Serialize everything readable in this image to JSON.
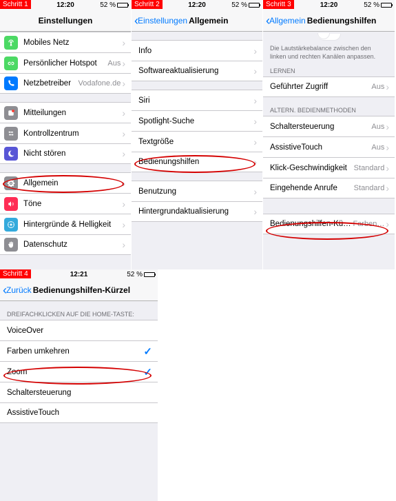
{
  "status": {
    "time": "12:20",
    "time4": "12:21",
    "battery": "52 %"
  },
  "steps": {
    "s1": "Schritt 1",
    "s2": "Schritt 2",
    "s3": "Schritt 3",
    "s4": "Schritt 4"
  },
  "p1": {
    "title": "Einstellungen",
    "items_a": [
      {
        "label": "Mobiles Netz"
      },
      {
        "label": "Persönlicher Hotspot",
        "detail": "Aus"
      },
      {
        "label": "Netzbetreiber",
        "detail": "Vodafone.de"
      }
    ],
    "items_b": [
      {
        "label": "Mitteilungen"
      },
      {
        "label": "Kontrollzentrum"
      },
      {
        "label": "Nicht stören"
      }
    ],
    "items_c": [
      {
        "label": "Allgemein"
      },
      {
        "label": "Töne"
      },
      {
        "label": "Hintergründe & Helligkeit"
      },
      {
        "label": "Datenschutz"
      }
    ]
  },
  "p2": {
    "back": "Einstellungen",
    "title": "Allgemein",
    "items_a": [
      {
        "label": "Info"
      },
      {
        "label": "Softwareaktualisierung"
      }
    ],
    "items_b": [
      {
        "label": "Siri"
      },
      {
        "label": "Spotlight-Suche"
      },
      {
        "label": "Textgröße"
      },
      {
        "label": "Bedienungshilfen"
      }
    ],
    "items_c": [
      {
        "label": "Benutzung"
      },
      {
        "label": "Hintergrundaktualisierung"
      }
    ]
  },
  "p3": {
    "back": "Allgemein",
    "title": "Bedienungshilfen",
    "hint": "Die Lautstärkebalance zwischen den linken und rechten Kanälen anpassen.",
    "hdr_learn": "LERNEN",
    "items_learn": [
      {
        "label": "Geführter Zugriff",
        "detail": "Aus"
      }
    ],
    "hdr_alt": "ALTERN. BEDIENMETHODEN",
    "items_alt": [
      {
        "label": "Schaltersteuerung",
        "detail": "Aus"
      },
      {
        "label": "AssistiveTouch",
        "detail": "Aus"
      },
      {
        "label": "Klick-Geschwindigkeit",
        "detail": "Standard"
      },
      {
        "label": "Eingehende Anrufe",
        "detail": "Standard"
      }
    ],
    "items_shortcut": [
      {
        "label": "Bedienungshilfen-Kürzel",
        "detail": "Farben…"
      }
    ]
  },
  "p4": {
    "back": "Zurück",
    "title": "Bedienungshilfen-Kürzel",
    "header": "DREIFACHKLICKEN AUF DIE HOME-TASTE:",
    "items": [
      {
        "label": "VoiceOver",
        "checked": false
      },
      {
        "label": "Farben umkehren",
        "checked": true
      },
      {
        "label": "Zoom",
        "checked": true
      },
      {
        "label": "Schaltersteuerung",
        "checked": false
      },
      {
        "label": "AssistiveTouch",
        "checked": false
      }
    ]
  }
}
